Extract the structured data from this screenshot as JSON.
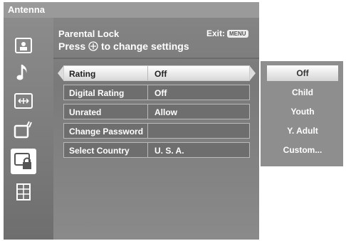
{
  "header": {
    "source": "Antenna"
  },
  "panel": {
    "title": "Parental Lock",
    "instruction_prefix": "Press",
    "instruction_suffix": "to change settings",
    "exit_label": "Exit:",
    "exit_key": "MENU"
  },
  "sidebar": {
    "icons": [
      "picture-icon",
      "music-note-icon",
      "screen-adjust-icon",
      "external-input-icon",
      "parental-lock-icon",
      "channel-list-icon"
    ],
    "selected": "parental-lock-icon"
  },
  "settings": [
    {
      "label": "Rating",
      "value": "Off",
      "selected": true
    },
    {
      "label": "Digital Rating",
      "value": "Off",
      "selected": false
    },
    {
      "label": "Unrated",
      "value": "Allow",
      "selected": false
    },
    {
      "label": "Change Password",
      "value": "",
      "selected": false
    },
    {
      "label": "Select Country",
      "value": "U. S. A.",
      "selected": false
    }
  ],
  "rating_options": [
    "Off",
    "Child",
    "Youth",
    "Y. Adult",
    "Custom..."
  ],
  "rating_selected": "Off",
  "colors": {
    "panel": "#848484",
    "sidebar": "#7c7c7c",
    "highlight": "#ffffff",
    "text": "#ffffff"
  }
}
